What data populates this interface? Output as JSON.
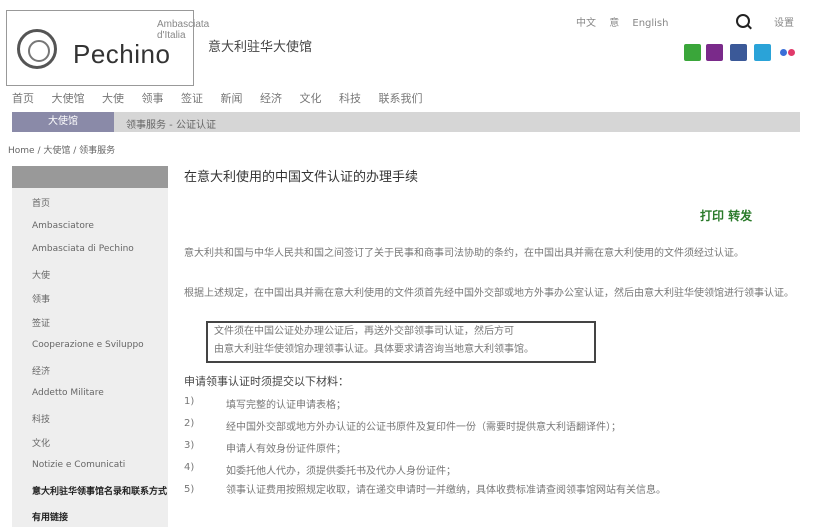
{
  "header": {
    "logo_text": "Pechino",
    "logo_small_text": "Ambasciata d'Italia",
    "site_subtitle": "意大利驻华大使馆",
    "top_links": [
      "中文",
      "意",
      "English"
    ],
    "top_right": "设置"
  },
  "social_colors": [
    "#3aa63a",
    "#7a2a8a",
    "#3b5998",
    "#2aa3d8",
    "#e03a6a"
  ],
  "nav": {
    "items": [
      "首页",
      "大使馆",
      "大使",
      "领事",
      "签证",
      "新闻",
      "经济",
      "文化",
      "科技",
      "联系我们"
    ]
  },
  "subbar": {
    "active_label": "大使馆",
    "item_label": "领事服务 - 公证认证"
  },
  "breadcrumb": "Home / 大使馆 / 领事服务",
  "sidebar": {
    "items": [
      "首页",
      "Ambasciatore",
      "Ambasciata di Pechino",
      "大使",
      "领事",
      "签证",
      "Cooperazione e Sviluppo",
      "经济",
      "Addetto Militare",
      "科技",
      "文化",
      "Notizie e Comunicati",
      "意大利驻华领事馆名录和联系方式",
      "有用链接"
    ]
  },
  "main": {
    "title": "在意大利使用的中国文件认证的办理手续",
    "print_links": "打印 转发",
    "para1": "意大利共和国与中华人民共和国之间签订了关于民事和商事司法协助的条约，在中国出具并需在意大利使用的文件须经过认证。",
    "para2": "根据上述规定，在中国出具并需在意大利使用的文件须首先经中国外交部或地方外事办公室认证，然后由意大利驻华使领馆进行领事认证。",
    "boxed1": "文件须在中国公证处办理公证后，再送外交部领事司认证，然后方可",
    "boxed2": "由意大利驻华使领馆办理领事认证。具体要求请咨询当地意大利领事馆。",
    "list_head": "申请领事认证时须提交以下材料：",
    "list": [
      {
        "num": "1)",
        "text": "填写完整的认证申请表格；"
      },
      {
        "num": "2)",
        "text": "经中国外交部或地方外办认证的公证书原件及复印件一份（需要时提供意大利语翻译件）；"
      },
      {
        "num": "3)",
        "text": "申请人有效身份证件原件；"
      },
      {
        "num": "4)",
        "text": "如委托他人代办，须提供委托书及代办人身份证件；"
      },
      {
        "num": "5)",
        "text": "领事认证费用按照规定收取，请在递交申请时一并缴纳，具体收费标准请查阅领事馆网站有关信息。"
      }
    ]
  }
}
